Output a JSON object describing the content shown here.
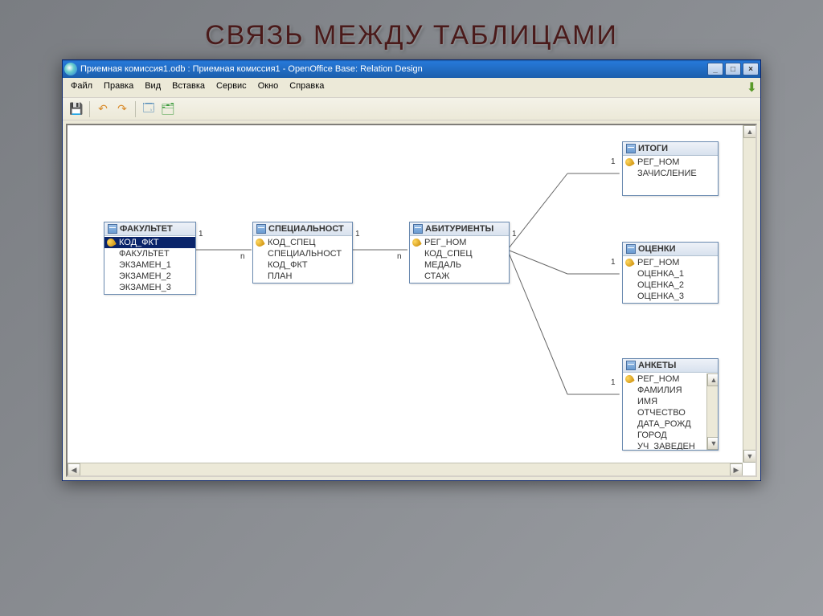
{
  "slide_title": "СВЯЗЬ МЕЖДУ ТАБЛИЦАМИ",
  "window": {
    "title": "Приемная комиссия1.odb : Приемная комиссия1 - OpenOffice Base: Relation Design",
    "min_glyph": "_",
    "max_glyph": "□",
    "close_glyph": "×"
  },
  "menu": [
    "Файл",
    "Правка",
    "Вид",
    "Вставка",
    "Сервис",
    "Окно",
    "Справка"
  ],
  "toolbar": {
    "save": "💾",
    "undo": "↶",
    "redo": "↷",
    "new_rel": "🗔",
    "add_tables": "🗂"
  },
  "entities": {
    "fakultet": {
      "title": "ФАКУЛЬТЕТ",
      "fields": [
        {
          "name": "КОД_ФКТ",
          "key": true,
          "selected": true
        },
        {
          "name": "ФАКУЛЬТЕТ"
        },
        {
          "name": "ЭКЗАМЕН_1"
        },
        {
          "name": "ЭКЗАМЕН_2"
        },
        {
          "name": "ЭКЗАМЕН_3"
        }
      ]
    },
    "specialnost": {
      "title": "СПЕЦИАЛЬНОСТ",
      "fields": [
        {
          "name": "КОД_СПЕЦ",
          "key": true
        },
        {
          "name": "СПЕЦИАЛЬНОСТ"
        },
        {
          "name": "КОД_ФКТ"
        },
        {
          "name": "ПЛАН"
        }
      ]
    },
    "abiturienty": {
      "title": "АБИТУРИЕНТЫ",
      "fields": [
        {
          "name": "РЕГ_НОМ",
          "key": true
        },
        {
          "name": "КОД_СПЕЦ"
        },
        {
          "name": "МЕДАЛЬ"
        },
        {
          "name": "СТАЖ"
        }
      ]
    },
    "itogi": {
      "title": "ИТОГИ",
      "fields": [
        {
          "name": "РЕГ_НОМ",
          "key": true
        },
        {
          "name": "ЗАЧИСЛЕНИЕ"
        }
      ]
    },
    "ocenki": {
      "title": "ОЦЕНКИ",
      "fields": [
        {
          "name": "РЕГ_НОМ",
          "key": true
        },
        {
          "name": "ОЦЕНКА_1"
        },
        {
          "name": "ОЦЕНКА_2"
        },
        {
          "name": "ОЦЕНКА_3"
        }
      ]
    },
    "ankety": {
      "title": "АНКЕТЫ",
      "fields": [
        {
          "name": "РЕГ_НОМ",
          "key": true
        },
        {
          "name": "ФАМИЛИЯ"
        },
        {
          "name": "ИМЯ"
        },
        {
          "name": "ОТЧЕСТВО"
        },
        {
          "name": "ДАТА_РОЖД"
        },
        {
          "name": "ГОРОД"
        },
        {
          "name": "УЧ_ЗАВЕДЕН"
        }
      ]
    }
  },
  "rel_labels": {
    "one": "1",
    "many": "n"
  }
}
